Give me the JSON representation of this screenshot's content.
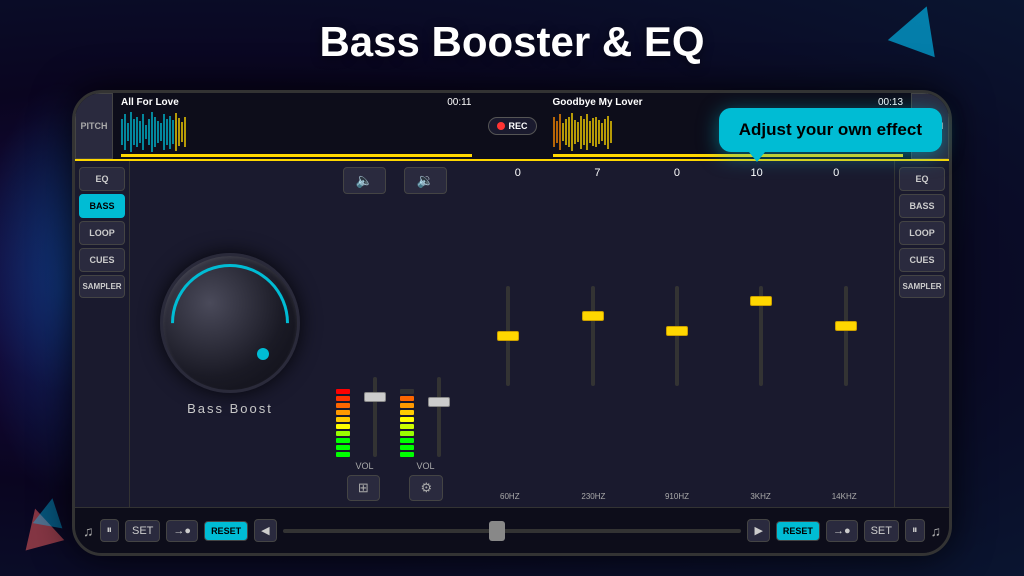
{
  "title": "Bass Booster & EQ",
  "tooltip": "Adjust your own effect",
  "phone": {
    "left_track": {
      "name": "All For Love",
      "time": "00:11"
    },
    "right_track": {
      "name": "Goodbye My Lover",
      "time": "00:13"
    },
    "rec_label": "REC",
    "pitch_label": "PITCH",
    "left_sidebar": [
      {
        "label": "EQ",
        "active": false
      },
      {
        "label": "BASS",
        "active": true
      },
      {
        "label": "LOOP",
        "active": false
      },
      {
        "label": "CUES",
        "active": false
      },
      {
        "label": "SAMPLER",
        "active": false
      }
    ],
    "right_sidebar": [
      {
        "label": "EQ",
        "active": false
      },
      {
        "label": "BASS",
        "active": false
      },
      {
        "label": "LOOP",
        "active": false
      },
      {
        "label": "CUES",
        "active": false
      },
      {
        "label": "SAMPLER",
        "active": false
      }
    ],
    "knob_label": "Bass  Boost",
    "eq_values": [
      "0",
      "7",
      "0",
      "10",
      "0"
    ],
    "eq_freqs": [
      "60HZ",
      "230HZ",
      "910HZ",
      "3KHZ",
      "14KHZ"
    ],
    "vol_left": "VOL",
    "vol_right": "VOL",
    "transport": {
      "set_label": "SET",
      "reset_label": "RESET"
    }
  }
}
